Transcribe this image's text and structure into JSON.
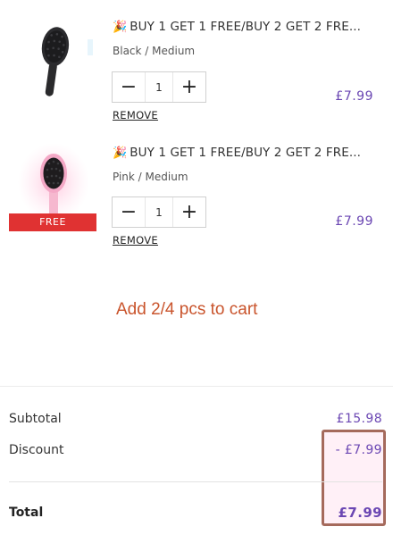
{
  "items": [
    {
      "title_icon": "party-popper-icon",
      "title": "BUY 1 GET 1 FREE/BUY 2 GET 2 FRE...",
      "variant": "Black / Medium",
      "qty": "1",
      "remove_label": "REMOVE",
      "price": "£7.99",
      "image": "black-hairbrush",
      "badge": ""
    },
    {
      "title_icon": "party-popper-icon",
      "title": "BUY 1 GET 1 FREE/BUY 2 GET 2 FRE...",
      "variant": "Pink / Medium",
      "qty": "1",
      "remove_label": "REMOVE",
      "price": "£7.99",
      "image": "pink-hairbrush",
      "badge": "FREE"
    }
  ],
  "promo_message": "Add 2/4 pcs to cart",
  "summary": {
    "subtotal_label": "Subtotal",
    "subtotal_value": "£15.98",
    "discount_label": "Discount",
    "discount_value": "- £7.99",
    "total_label": "Total",
    "total_value": "£7.99"
  },
  "colors": {
    "price": "#6b47b3",
    "badge": "#e03232",
    "promo": "#c9542c",
    "highlight_border": "#a56a5c"
  }
}
